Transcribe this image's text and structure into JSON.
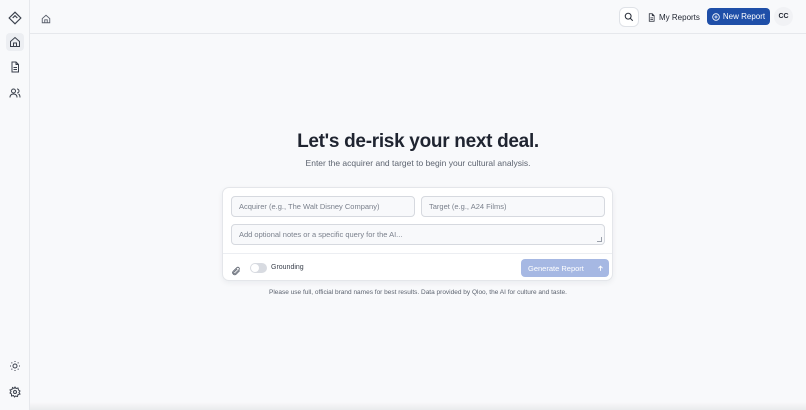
{
  "sidebar": {
    "items": [
      {
        "icon": "logo-diamond-icon"
      },
      {
        "icon": "home-icon"
      },
      {
        "icon": "document-icon"
      },
      {
        "icon": "users-icon"
      }
    ],
    "bottom": [
      {
        "icon": "sun-icon"
      },
      {
        "icon": "gear-icon"
      }
    ]
  },
  "header": {
    "breadcrumb_icon": "home-icon",
    "my_reports": "My Reports",
    "new_report": "New Report",
    "avatar_initials": "CC",
    "accent_color": "#1f4fa8"
  },
  "main": {
    "headline": "Let's de-risk your next deal.",
    "subhead": "Enter the acquirer and target to begin your cultural analysis."
  },
  "form": {
    "acquirer_placeholder": "Acquirer (e.g., The Walt Disney Company)",
    "target_placeholder": "Target (e.g., A24 Films)",
    "notes_placeholder": "Add optional notes or a specific query for the AI...",
    "grounding_label": "Grounding",
    "grounding_on": false,
    "generate_label": "Generate Report",
    "generate_color": "#a6b8e3"
  },
  "footnote": "Please use full, official brand names for best results. Data provided by Qloo, the AI for culture and taste."
}
